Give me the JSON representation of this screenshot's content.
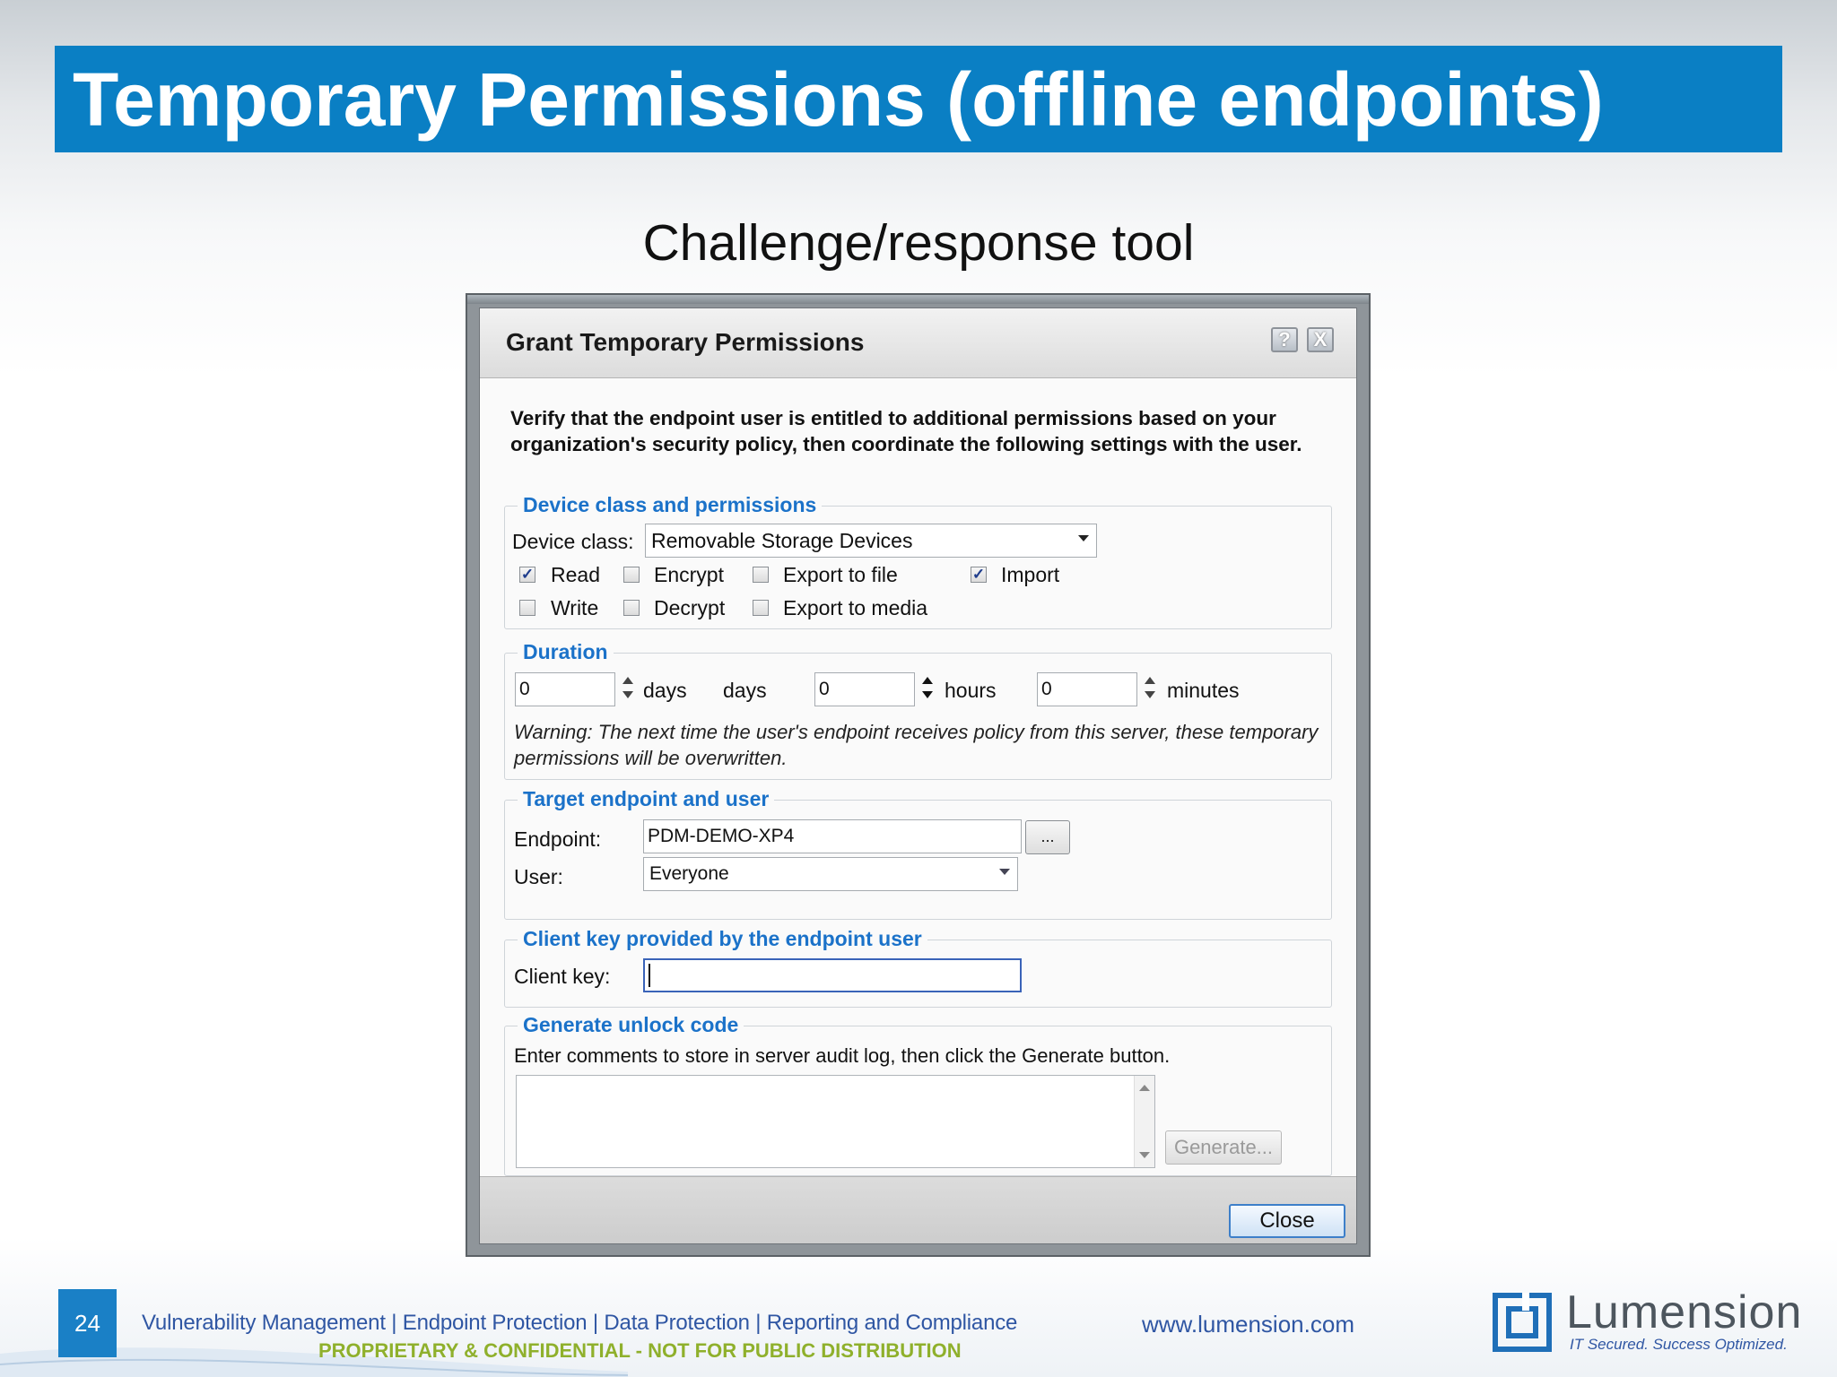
{
  "slide": {
    "title": "Temporary Permissions (offline endpoints)",
    "subtitle": "Challenge/response tool",
    "page_number": "24",
    "footer_tagline": "Vulnerability Management | Endpoint Protection | Data Protection | Reporting and Compliance",
    "footer_confidential": "PROPRIETARY & CONFIDENTIAL - NOT FOR PUBLIC DISTRIBUTION",
    "footer_url": "www.lumension.com",
    "logo_name": "Lumension",
    "logo_tagline": "IT Secured. Success Optimized."
  },
  "colors": {
    "title_bar": "#0a7fc4",
    "section_heading": "#1b72c9",
    "footer_text": "#2f56a3",
    "confidential_text": "#8fb02c"
  },
  "dialog": {
    "title": "Grant Temporary Permissions",
    "help_icon": "?",
    "close_icon": "X",
    "intro": "Verify that the endpoint user is entitled to additional permissions based on your organization's security policy, then coordinate the following settings with the user.",
    "device_section": {
      "heading": "Device class and permissions",
      "device_class_label": "Device class:",
      "device_class_value": "Removable Storage Devices",
      "checkboxes": [
        {
          "label": "Read",
          "checked": true
        },
        {
          "label": "Encrypt",
          "checked": false
        },
        {
          "label": "Export to file",
          "checked": false
        },
        {
          "label": "Import",
          "checked": true
        },
        {
          "label": "Write",
          "checked": false
        },
        {
          "label": "Decrypt",
          "checked": false
        },
        {
          "label": "Export to media",
          "checked": false
        }
      ]
    },
    "duration_section": {
      "heading": "Duration",
      "days_value": "0",
      "days_unit": "days",
      "days_label": "days",
      "hours_value": "0",
      "hours_unit": "hours",
      "minutes_value": "0",
      "minutes_unit": "minutes",
      "warning_prefix": "Warning:",
      "warning_text": "The next time the user's endpoint receives policy from this server, these temporary permissions will be overwritten."
    },
    "target_section": {
      "heading": "Target endpoint and user",
      "endpoint_label": "Endpoint:",
      "endpoint_value": "PDM-DEMO-XP4",
      "browse_label": "...",
      "user_label": "User:",
      "user_value": "Everyone"
    },
    "client_key_section": {
      "heading": "Client key provided by the endpoint user",
      "client_key_label": "Client key:",
      "client_key_value": ""
    },
    "generate_section": {
      "heading": "Generate unlock code",
      "instructions": "Enter comments to store in server audit log, then click the Generate button.",
      "comments_value": "",
      "generate_label": "Generate..."
    },
    "close_label": "Close"
  }
}
